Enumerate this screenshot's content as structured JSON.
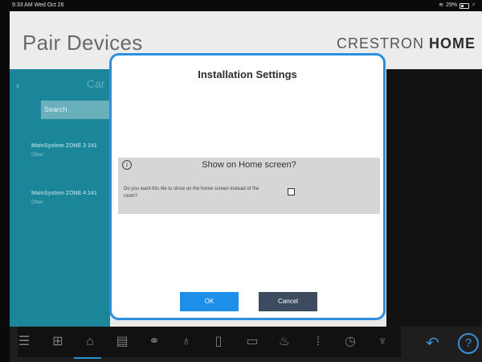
{
  "status_bar": {
    "time_date": "9:33 AM  Wed Oct 26",
    "battery": "29%"
  },
  "header": {
    "title": "Pair Devices",
    "brand_light": "CRESTRON",
    "brand_bold": "HOME"
  },
  "left_panel": {
    "back_icon": "chevron-left-icon",
    "category_partial": "Car",
    "search_placeholder": "Search",
    "devices": [
      {
        "name": "MainSystem ZONE 3 141",
        "type": "Other"
      },
      {
        "name": "MainSystem ZONE 4 141",
        "type": "Other"
      }
    ]
  },
  "dialog": {
    "title": "Installation Settings",
    "setting": {
      "title": "Show on Home screen?",
      "question": "Do you want this tile to show on the home screen instead of the room?",
      "checked": false
    },
    "ok_label": "OK",
    "cancel_label": "Cancel"
  },
  "bottom_bar": {
    "icons": [
      "menu-icon",
      "add-device-icon",
      "network-icon",
      "shades-icon",
      "scene-icon",
      "light-icon",
      "door-icon",
      "media-icon",
      "thermostat-icon",
      "keypad-icon",
      "clock-icon",
      "temperature-icon"
    ],
    "undo_icon": "undo-icon",
    "help_icon": "help-icon"
  },
  "colors": {
    "accent": "#2d8fe0",
    "panel_teal": "#1b8599",
    "ok_button": "#1e8fe8",
    "cancel_button": "#3d4b60"
  }
}
